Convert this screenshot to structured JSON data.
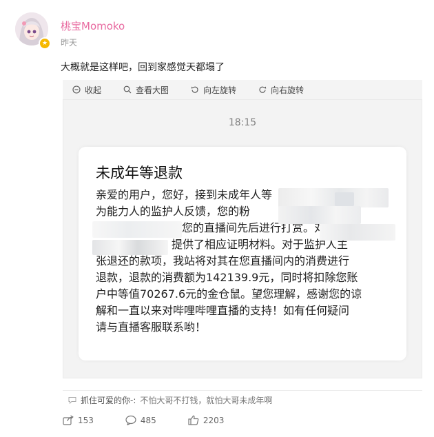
{
  "post": {
    "username": "桃宝Momoko",
    "time": "昨天",
    "text": "大概就是这样吧，回到家感觉天都塌了"
  },
  "toolbar": {
    "items": [
      {
        "label": "收起",
        "icon": "collapse-icon"
      },
      {
        "label": "查看大图",
        "icon": "search-icon"
      },
      {
        "label": "向左旋转",
        "icon": "rotate-left-icon"
      },
      {
        "label": "向右旋转",
        "icon": "rotate-right-icon"
      }
    ]
  },
  "screenshot": {
    "time": "18:15",
    "title": "未成年等退款",
    "lines": [
      "亲爱的用户，您好，接到未成年人等",
      "为能力人的监护人反馈，您的粉",
      "您的直播间先后进行打赏。对",
      "提供了相应证明材料。对于监护人主",
      "张退还的款项，我站将对其在您直播间内的消费进行",
      "退款，退款的消费额为142139.9元，同时将扣除您账",
      "户中等值70267.6元的金仓鼠。望您理解，感谢您的谅",
      "解和一直以来对哔哩哔哩直播的支持！如有任何疑问",
      "请与直播客服联系哟！"
    ]
  },
  "comment": {
    "author": "抓住可爱的你-:",
    "text": "不怕大哥不打钱，就怕大哥未成年啊"
  },
  "actions": {
    "share_count": "153",
    "comment_count": "485",
    "like_count": "2203"
  },
  "colors": {
    "username": "#e86aa0",
    "badge": "#f6b800"
  }
}
